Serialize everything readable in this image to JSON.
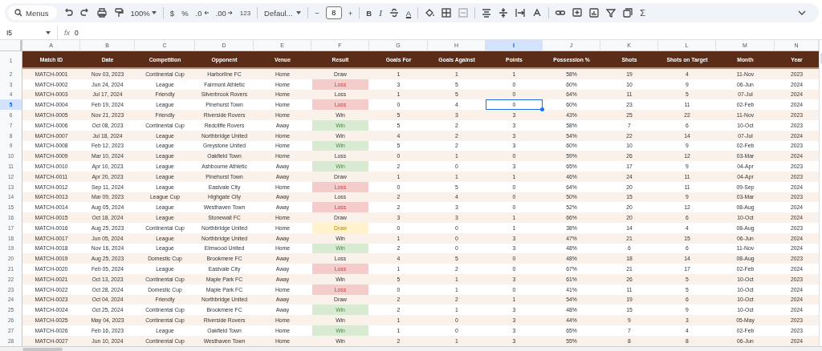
{
  "toolbar": {
    "search": "Menus",
    "zoom": "100%",
    "currency": "$",
    "percent": "%",
    "decrease_decimals": ".0",
    "increase_decimals": ".00",
    "number_format": "123",
    "font": "Defaul...",
    "minus": "−",
    "font_size": "8",
    "plus": "+",
    "bold": "B",
    "italic": "I",
    "text_color": "A",
    "functions": "Σ"
  },
  "formula_bar": {
    "cell": "I5",
    "fx_label": "fx",
    "value": "0"
  },
  "columns": [
    {
      "letter": "A",
      "title": "Match ID",
      "selected": false
    },
    {
      "letter": "B",
      "title": "Date",
      "selected": false
    },
    {
      "letter": "C",
      "title": "Competition",
      "selected": false
    },
    {
      "letter": "D",
      "title": "Opponent",
      "selected": false
    },
    {
      "letter": "E",
      "title": "Venue",
      "selected": false
    },
    {
      "letter": "F",
      "title": "Result",
      "selected": false
    },
    {
      "letter": "G",
      "title": "Goals For",
      "selected": false
    },
    {
      "letter": "H",
      "title": "Goals Against",
      "selected": false
    },
    {
      "letter": "I",
      "title": "Points",
      "selected": true
    },
    {
      "letter": "J",
      "title": "Possession %",
      "selected": false
    },
    {
      "letter": "K",
      "title": "Shots",
      "selected": false
    },
    {
      "letter": "L",
      "title": "Shots on Target",
      "selected": false
    },
    {
      "letter": "M",
      "title": "Month",
      "selected": false
    },
    {
      "letter": "N",
      "title": "Year",
      "selected": false
    }
  ],
  "header_row_number": "1",
  "rows": [
    {
      "number": "2",
      "selected": false,
      "kind": "plain",
      "cells": [
        "MATCH-0001",
        "Nov 03, 2023",
        "Continental Cup",
        "Harborline FC",
        "Home",
        "Draw",
        "1",
        "1",
        "1",
        "58%",
        "19",
        "4",
        "11-Nov",
        "2023"
      ]
    },
    {
      "number": "3",
      "selected": false,
      "kind": "loss",
      "cells": [
        "MATCH-0002",
        "Jun 24, 2024",
        "League",
        "Fairmont Athletic",
        "Home",
        "Loss",
        "3",
        "5",
        "0",
        "60%",
        "10",
        "9",
        "06-Jun",
        "2024"
      ]
    },
    {
      "number": "4",
      "selected": false,
      "kind": "plain",
      "cells": [
        "MATCH-0003",
        "Jul 17, 2024",
        "Friendly",
        "Silverbrook Rovers",
        "Home",
        "Loss",
        "1",
        "5",
        "0",
        "64%",
        "11",
        "5",
        "07-Jul",
        "2024"
      ]
    },
    {
      "number": "5",
      "selected": true,
      "kind": "loss",
      "cells": [
        "MATCH-0004",
        "Feb 19, 2024",
        "League",
        "Pinehurst Town",
        "Home",
        "Loss",
        "0",
        "4",
        "0",
        "60%",
        "23",
        "11",
        "02-Feb",
        "2024"
      ]
    },
    {
      "number": "6",
      "selected": false,
      "kind": "plain",
      "cells": [
        "MATCH-0005",
        "Nov 21, 2023",
        "Friendly",
        "Riverside Rovers",
        "Home",
        "Win",
        "5",
        "3",
        "3",
        "43%",
        "25",
        "22",
        "11-Nov",
        "2023"
      ]
    },
    {
      "number": "7",
      "selected": false,
      "kind": "win",
      "cells": [
        "MATCH-0006",
        "Oct 08, 2023",
        "Continental Cup",
        "Redcliffe Rovers",
        "Away",
        "Win",
        "5",
        "2",
        "3",
        "58%",
        "7",
        "6",
        "10-Oct",
        "2023"
      ]
    },
    {
      "number": "8",
      "selected": false,
      "kind": "plain",
      "cells": [
        "MATCH-0007",
        "Jul 18, 2024",
        "League",
        "Northbridge United",
        "Home",
        "Win",
        "4",
        "2",
        "3",
        "54%",
        "22",
        "14",
        "07-Jul",
        "2024"
      ]
    },
    {
      "number": "9",
      "selected": false,
      "kind": "win",
      "cells": [
        "MATCH-0008",
        "Feb 12, 2023",
        "League",
        "Greystone United",
        "Home",
        "Win",
        "5",
        "2",
        "3",
        "60%",
        "10",
        "9",
        "02-Feb",
        "2023"
      ]
    },
    {
      "number": "10",
      "selected": false,
      "kind": "plain",
      "cells": [
        "MATCH-0009",
        "Mar 10, 2024",
        "League",
        "Oakfield Town",
        "Home",
        "Loss",
        "0",
        "1",
        "0",
        "59%",
        "26",
        "12",
        "03-Mar",
        "2024"
      ]
    },
    {
      "number": "11",
      "selected": false,
      "kind": "win",
      "cells": [
        "MATCH-0010",
        "Apr 10, 2023",
        "League",
        "Ashbourne Athletic",
        "Away",
        "Win",
        "2",
        "0",
        "3",
        "65%",
        "17",
        "9",
        "04-Apr",
        "2023"
      ]
    },
    {
      "number": "12",
      "selected": false,
      "kind": "plain",
      "cells": [
        "MATCH-0011",
        "Apr 20, 2023",
        "League",
        "Pinehurst Town",
        "Away",
        "Draw",
        "1",
        "1",
        "1",
        "46%",
        "24",
        "11",
        "04-Apr",
        "2023"
      ]
    },
    {
      "number": "13",
      "selected": false,
      "kind": "loss",
      "cells": [
        "MATCH-0012",
        "Sep 11, 2024",
        "League",
        "Eastvale City",
        "Home",
        "Loss",
        "0",
        "5",
        "0",
        "64%",
        "20",
        "11",
        "09-Sep",
        "2024"
      ]
    },
    {
      "number": "14",
      "selected": false,
      "kind": "plain",
      "cells": [
        "MATCH-0013",
        "Mar 09, 2023",
        "League Cup",
        "Highgate City",
        "Away",
        "Loss",
        "2",
        "4",
        "0",
        "50%",
        "15",
        "9",
        "03-Mar",
        "2023"
      ]
    },
    {
      "number": "15",
      "selected": false,
      "kind": "loss",
      "cells": [
        "MATCH-0014",
        "Aug 05, 2024",
        "League",
        "Westhaven Town",
        "Away",
        "Loss",
        "2",
        "3",
        "0",
        "52%",
        "20",
        "12",
        "08-Aug",
        "2024"
      ]
    },
    {
      "number": "16",
      "selected": false,
      "kind": "plain",
      "cells": [
        "MATCH-0015",
        "Oct 18, 2024",
        "League",
        "Stonewall FC",
        "Home",
        "Draw",
        "3",
        "3",
        "1",
        "66%",
        "20",
        "6",
        "10-Oct",
        "2024"
      ]
    },
    {
      "number": "17",
      "selected": false,
      "kind": "draw",
      "cells": [
        "MATCH-0016",
        "Aug 25, 2023",
        "Continental Cup",
        "Northbridge United",
        "Home",
        "Draw",
        "0",
        "0",
        "1",
        "38%",
        "14",
        "4",
        "08-Aug",
        "2023"
      ]
    },
    {
      "number": "18",
      "selected": false,
      "kind": "plain",
      "cells": [
        "MATCH-0017",
        "Jun 05, 2024",
        "League",
        "Northbridge United",
        "Away",
        "Win",
        "1",
        "0",
        "3",
        "47%",
        "21",
        "15",
        "06-Jun",
        "2024"
      ]
    },
    {
      "number": "19",
      "selected": false,
      "kind": "win",
      "cells": [
        "MATCH-0018",
        "Nov 16, 2024",
        "League",
        "Elmwood United",
        "Home",
        "Win",
        "2",
        "0",
        "3",
        "48%",
        "6",
        "6",
        "11-Nov",
        "2024"
      ]
    },
    {
      "number": "20",
      "selected": false,
      "kind": "plain",
      "cells": [
        "MATCH-0019",
        "Aug 25, 2023",
        "Domestic Cup",
        "Brookmere FC",
        "Away",
        "Loss",
        "4",
        "5",
        "0",
        "48%",
        "18",
        "14",
        "08-Aug",
        "2023"
      ]
    },
    {
      "number": "21",
      "selected": false,
      "kind": "loss",
      "cells": [
        "MATCH-0020",
        "Feb 05, 2024",
        "League",
        "Eastvale City",
        "Away",
        "Loss",
        "1",
        "2",
        "0",
        "67%",
        "21",
        "17",
        "02-Feb",
        "2024"
      ]
    },
    {
      "number": "22",
      "selected": false,
      "kind": "plain",
      "cells": [
        "MATCH-0021",
        "Oct 13, 2023",
        "Continental Cup",
        "Maple Park FC",
        "Away",
        "Win",
        "5",
        "1",
        "3",
        "61%",
        "26",
        "5",
        "10-Oct",
        "2023"
      ]
    },
    {
      "number": "23",
      "selected": false,
      "kind": "loss",
      "cells": [
        "MATCH-0022",
        "Oct 28, 2024",
        "Domestic Cup",
        "Maple Park FC",
        "Home",
        "Loss",
        "0",
        "1",
        "0",
        "41%",
        "11",
        "5",
        "10-Oct",
        "2024"
      ]
    },
    {
      "number": "24",
      "selected": false,
      "kind": "plain",
      "cells": [
        "MATCH-0023",
        "Oct 04, 2024",
        "Friendly",
        "Northbridge United",
        "Away",
        "Draw",
        "2",
        "2",
        "1",
        "54%",
        "19",
        "6",
        "10-Oct",
        "2024"
      ]
    },
    {
      "number": "25",
      "selected": false,
      "kind": "win",
      "cells": [
        "MATCH-0024",
        "Oct 25, 2024",
        "Continental Cup",
        "Brookmere FC",
        "Away",
        "Win",
        "2",
        "1",
        "3",
        "48%",
        "15",
        "9",
        "10-Oct",
        "2024"
      ]
    },
    {
      "number": "26",
      "selected": false,
      "kind": "plain",
      "cells": [
        "MATCH-0025",
        "May 04, 2023",
        "Continental Cup",
        "Riverside Rovers",
        "Home",
        "Win",
        "1",
        "0",
        "3",
        "44%",
        "9",
        "3",
        "05-May",
        "2023"
      ]
    },
    {
      "number": "27",
      "selected": false,
      "kind": "win",
      "cells": [
        "MATCH-0026",
        "Feb 16, 2023",
        "League",
        "Oakfield Town",
        "Home",
        "Win",
        "1",
        "0",
        "3",
        "65%",
        "7",
        "4",
        "02-Feb",
        "2023"
      ]
    },
    {
      "number": "28",
      "selected": false,
      "kind": "plain",
      "cells": [
        "MATCH-0027",
        "Jun 10, 2024",
        "Continental Cup",
        "Westhaven Town",
        "Home",
        "Win",
        "2",
        "1",
        "3",
        "55%",
        "8",
        "8",
        "06-Jun",
        "2024"
      ]
    }
  ]
}
